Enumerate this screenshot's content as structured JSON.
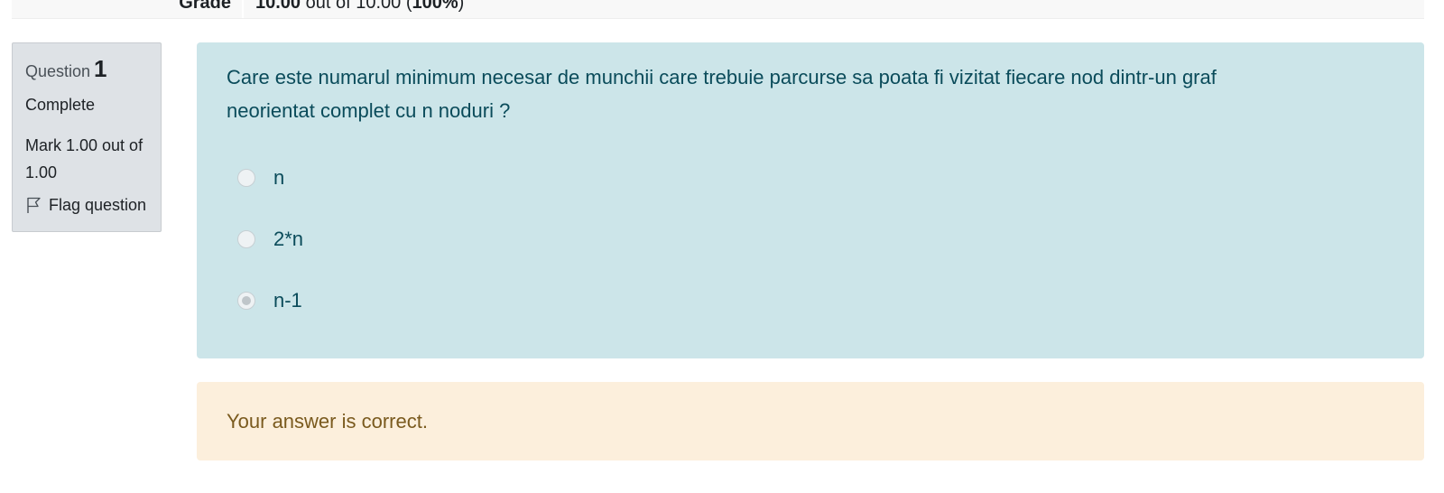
{
  "summary": {
    "grade_label": "Grade",
    "grade_value": "10.00",
    "grade_out_of": "out of 10.00",
    "grade_percent": "100%"
  },
  "question_info": {
    "question_word": "Question",
    "question_number": "1",
    "state": "Complete",
    "mark": "Mark 1.00 out of 1.00",
    "flag_label": "Flag question"
  },
  "question": {
    "text": "Care este numarul minimum necesar de munchii care trebuie parcurse sa poata fi vizitat fiecare nod dintr-un graf neorientat complet cu n noduri ?",
    "answers": [
      {
        "label": "n",
        "selected": false
      },
      {
        "label": "2*n",
        "selected": false
      },
      {
        "label": "n-1",
        "selected": true
      }
    ]
  },
  "feedback": {
    "text": "Your answer is correct."
  },
  "colors": {
    "question_bg": "#cce5e9",
    "feedback_bg": "#fcefdc",
    "info_bg": "#dee2e6"
  }
}
